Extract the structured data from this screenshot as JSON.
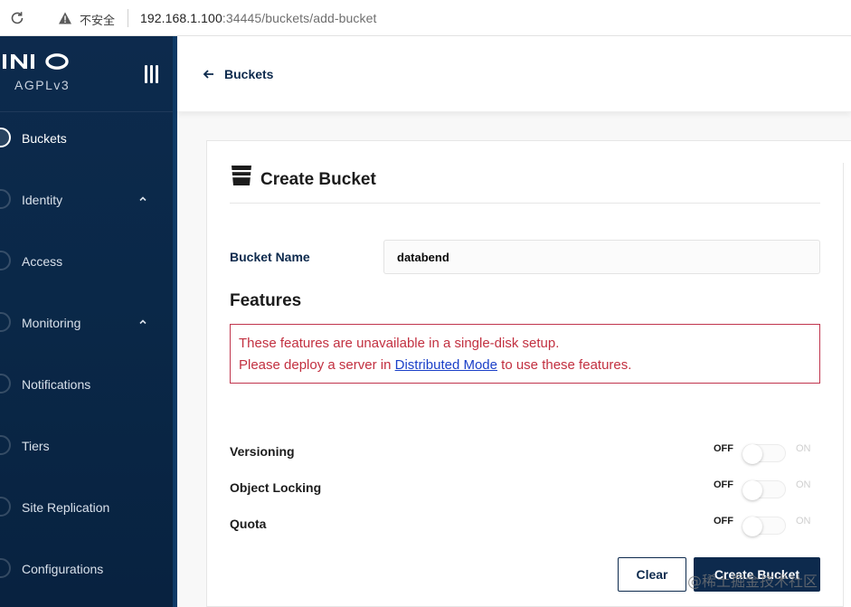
{
  "browser": {
    "insecure_label": "不安全",
    "url_host": "192.168.1.100",
    "url_rest": ":34445/buckets/add-bucket"
  },
  "sidebar": {
    "logo_text": "MINIO",
    "license": "AGPLv3",
    "items": [
      {
        "label": "Buckets",
        "active": true,
        "expandable": false
      },
      {
        "label": "Identity",
        "active": false,
        "expandable": true
      },
      {
        "label": "Access",
        "active": false,
        "expandable": false
      },
      {
        "label": "Monitoring",
        "active": false,
        "expandable": true
      },
      {
        "label": "Notifications",
        "active": false,
        "expandable": false
      },
      {
        "label": "Tiers",
        "active": false,
        "expandable": false
      },
      {
        "label": "Site Replication",
        "active": false,
        "expandable": false
      },
      {
        "label": "Configurations",
        "active": false,
        "expandable": false
      }
    ]
  },
  "header": {
    "back_label": "Buckets"
  },
  "form": {
    "title": "Create Bucket",
    "bucket_name_label": "Bucket Name",
    "bucket_name_value": "databend",
    "features_title": "Features",
    "alert_line1": "These features are unavailable in a single-disk setup.",
    "alert_line2_prefix": "Please deploy a server in ",
    "alert_link": "Distributed Mode",
    "alert_line2_suffix": " to use these features.",
    "toggles": [
      {
        "label": "Versioning",
        "off_label": "OFF",
        "on_label": "ON",
        "value": "OFF"
      },
      {
        "label": "Object Locking",
        "off_label": "OFF",
        "on_label": "ON",
        "value": "OFF"
      },
      {
        "label": "Quota",
        "off_label": "OFF",
        "on_label": "ON",
        "value": "OFF"
      }
    ],
    "clear_label": "Clear",
    "create_label": "Create Bucket"
  },
  "watermark": "@稀土掘金技术社区",
  "colors": {
    "brand_navy": "#0d2a4d",
    "alert_red": "#c23040",
    "link_blue": "#1a3fc8"
  }
}
